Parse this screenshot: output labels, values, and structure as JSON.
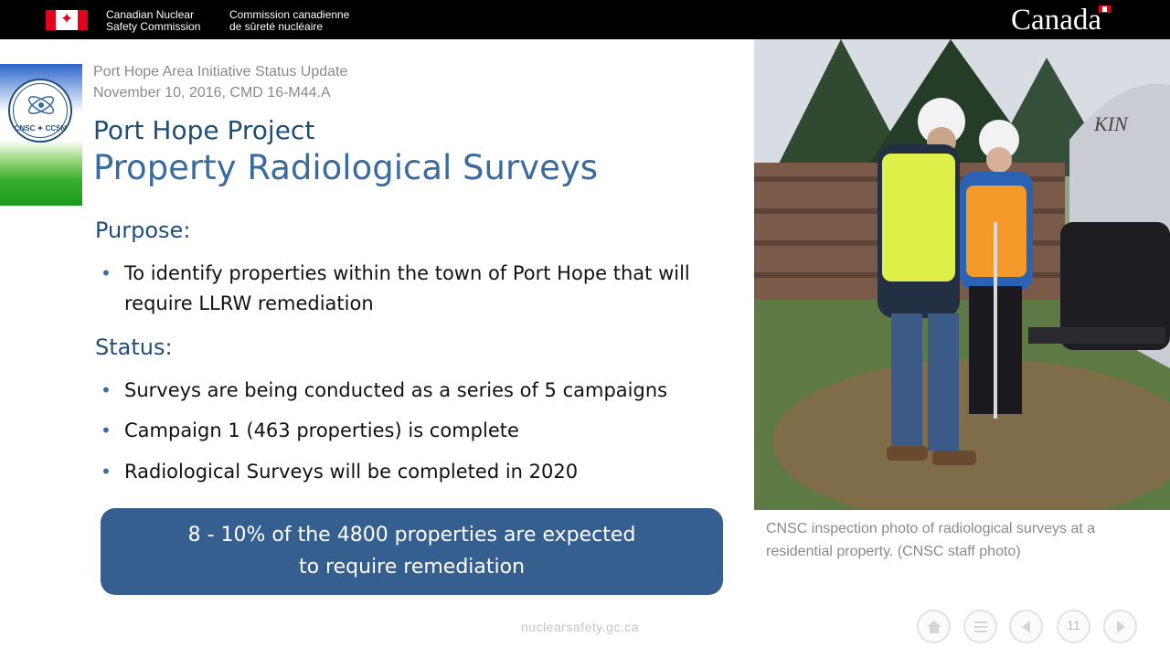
{
  "header": {
    "agency_en": [
      "Canadian Nuclear",
      "Safety Commission"
    ],
    "agency_fr": [
      "Commission canadienne",
      "de sûreté nucléaire"
    ],
    "wordmark": "Canada",
    "colors": {
      "bar": "#000000",
      "flag_red": "#e3001b"
    }
  },
  "logo": {
    "icon": "cnsc-seal-icon",
    "text": "CNSC ✦ CCSN"
  },
  "slide": {
    "meta_line1": "Port Hope Area Initiative Status Update",
    "meta_line2": "November 10, 2016,  CMD 16-M44.A",
    "title_line1": "Port Hope Project",
    "title_line2": "Property Radiological Surveys",
    "purpose_heading": "Purpose:",
    "purpose_bullets": [
      "To identify properties within the town of Port Hope that will require LLRW remediation"
    ],
    "status_heading": "Status:",
    "status_bullets": [
      "Surveys are being conducted as a series of 5 campaigns",
      "Campaign 1 (463 properties)  is complete",
      "Radiological Surveys will be completed  in 2020"
    ],
    "callout_line1": "8 - 10% of the 4800 properties are expected",
    "callout_line2": "to require remediation",
    "colors": {
      "title": "#1f4e79",
      "heading": "#1f4e79",
      "callout": "#355f8f"
    }
  },
  "photo": {
    "caption": "CNSC inspection photo  of radiological surveys at a residential property.  (CNSC staff photo)",
    "trailer_text": "KIN"
  },
  "footer": {
    "url": "nuclearsafety.gc.ca",
    "page_number": "11",
    "icons": [
      "home-icon",
      "menu-icon",
      "prev-icon",
      "next-icon"
    ]
  }
}
